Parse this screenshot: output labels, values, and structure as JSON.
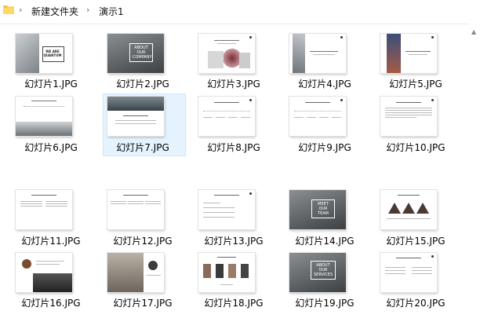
{
  "address_bar": {
    "crumbs": [
      "新建文件夹",
      "演示1"
    ]
  },
  "files": [
    {
      "name": "幻灯片1.JPG"
    },
    {
      "name": "幻灯片2.JPG"
    },
    {
      "name": "幻灯片3.JPG"
    },
    {
      "name": "幻灯片4.JPG"
    },
    {
      "name": "幻灯片5.JPG"
    },
    {
      "name": "幻灯片6.JPG"
    },
    {
      "name": "幻灯片7.JPG"
    },
    {
      "name": "幻灯片8.JPG"
    },
    {
      "name": "幻灯片9.JPG"
    },
    {
      "name": "幻灯片10.JPG"
    },
    {
      "name": "幻灯片11.JPG"
    },
    {
      "name": "幻灯片12.JPG"
    },
    {
      "name": "幻灯片13.JPG"
    },
    {
      "name": "幻灯片14.JPG"
    },
    {
      "name": "幻灯片15.JPG"
    },
    {
      "name": "幻灯片16.JPG"
    },
    {
      "name": "幻灯片17.JPG"
    },
    {
      "name": "幻灯片18.JPG"
    },
    {
      "name": "幻灯片19.JPG"
    },
    {
      "name": "幻灯片20.JPG"
    }
  ],
  "slide_texts": {
    "s1": "WE ARE QUANTUM",
    "s2": "ABOUT OUR COMPANY",
    "s14": "MEET OUR TEAM",
    "s19": "ABOUT OUR SERVICES"
  },
  "selected_index": 6
}
